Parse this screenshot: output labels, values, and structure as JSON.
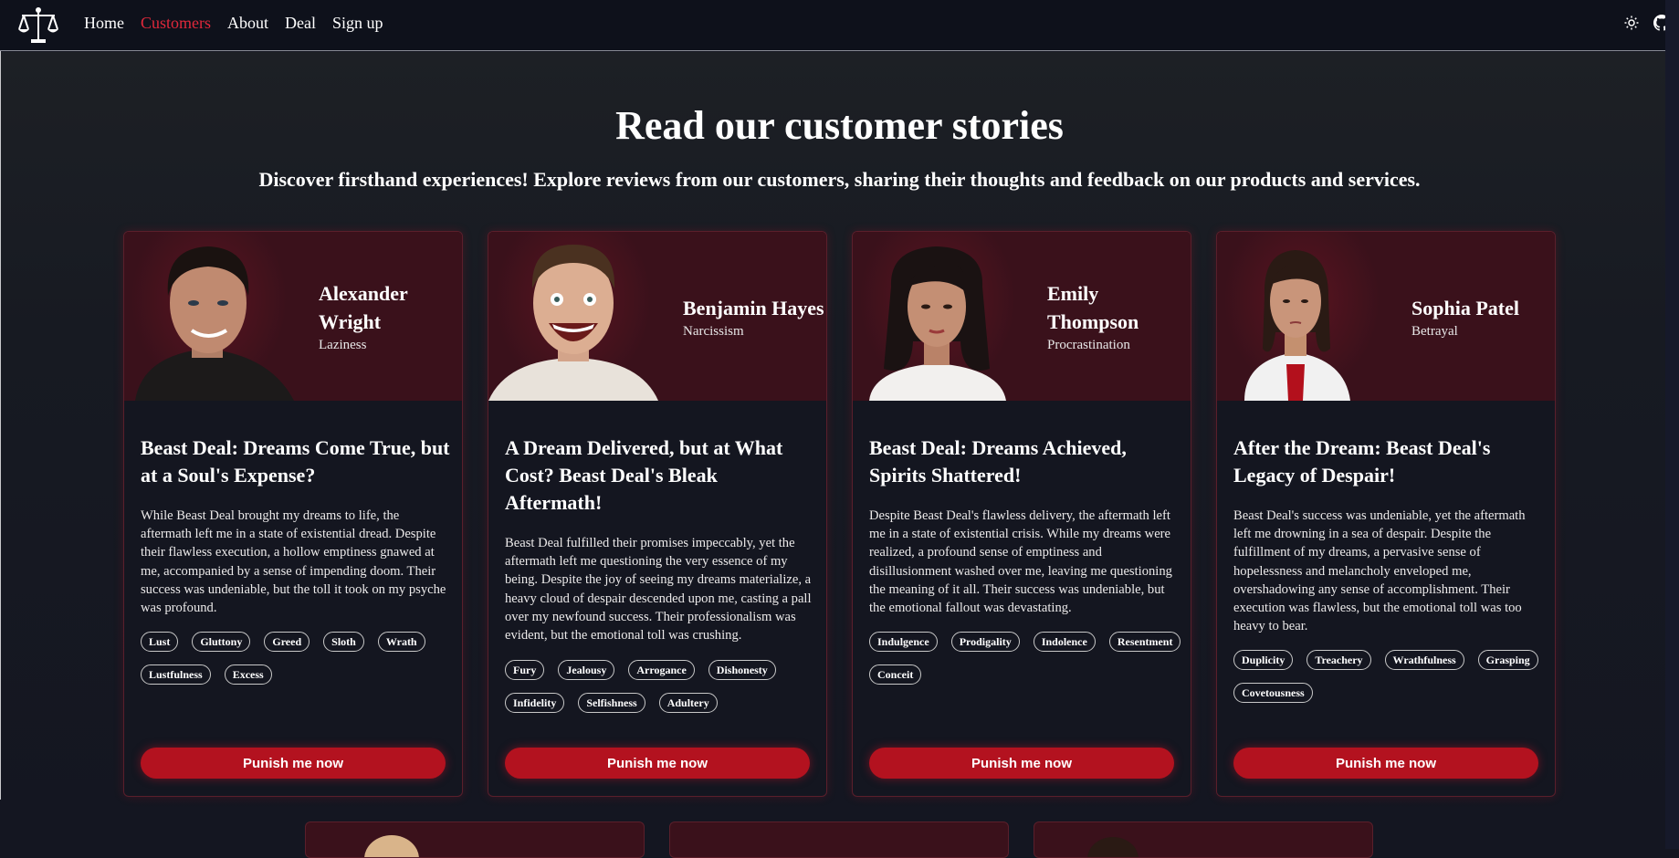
{
  "nav": {
    "links": [
      "Home",
      "Customers",
      "About",
      "Deal",
      "Sign up"
    ],
    "active": "Customers"
  },
  "page": {
    "title": "Read our customer stories",
    "subtitle": "Discover firsthand experiences! Explore reviews from our customers, sharing their thoughts and feedback on our products and services."
  },
  "cta_label": "Punish me now",
  "customers": [
    {
      "name": "Alexander Wright",
      "sin": "Laziness",
      "title": "Beast Deal: Dreams Come True, but at a Soul's Expense?",
      "text": "While Beast Deal brought my dreams to life, the aftermath left me in a state of existential dread. Despite their flawless execution, a hollow emptiness gnawed at me, accompanied by a sense of impending doom. Their success was undeniable, but the toll it took on my psyche was profound.",
      "tags": [
        "Lust",
        "Gluttony",
        "Greed",
        "Sloth",
        "Wrath",
        "Lustfulness",
        "Excess"
      ]
    },
    {
      "name": "Benjamin Hayes",
      "sin": "Narcissism",
      "title": "A Dream Delivered, but at What Cost? Beast Deal's Bleak Aftermath!",
      "text": "Beast Deal fulfilled their promises impeccably, yet the aftermath left me questioning the very essence of my being. Despite the joy of seeing my dreams materialize, a heavy cloud of despair descended upon me, casting a pall over my newfound success. Their professionalism was evident, but the emotional toll was crushing.",
      "tags": [
        "Fury",
        "Jealousy",
        "Arrogance",
        "Dishonesty",
        "Infidelity",
        "Selfishness",
        "Adultery"
      ]
    },
    {
      "name": "Emily Thompson",
      "sin": "Procrastination",
      "title": "Beast Deal: Dreams Achieved, Spirits Shattered!",
      "text": "Despite Beast Deal's flawless delivery, the aftermath left me in a state of existential crisis. While my dreams were realized, a profound sense of emptiness and disillusionment washed over me, leaving me questioning the meaning of it all. Their success was undeniable, but the emotional fallout was devastating.",
      "tags": [
        "Indulgence",
        "Prodigality",
        "Indolence",
        "Resentment",
        "Conceit"
      ]
    },
    {
      "name": "Sophia Patel",
      "sin": "Betrayal",
      "title": "After the Dream: Beast Deal's Legacy of Despair!",
      "text": "Beast Deal's success was undeniable, yet the aftermath left me drowning in a sea of despair. Despite the fulfillment of my dreams, a pervasive sense of hopelessness and melancholy enveloped me, overshadowing any sense of accomplishment. Their execution was flawless, but the emotional toll was too heavy to bear.",
      "tags": [
        "Duplicity",
        "Treachery",
        "Wrathfulness",
        "Grasping",
        "Covetousness"
      ]
    }
  ]
}
